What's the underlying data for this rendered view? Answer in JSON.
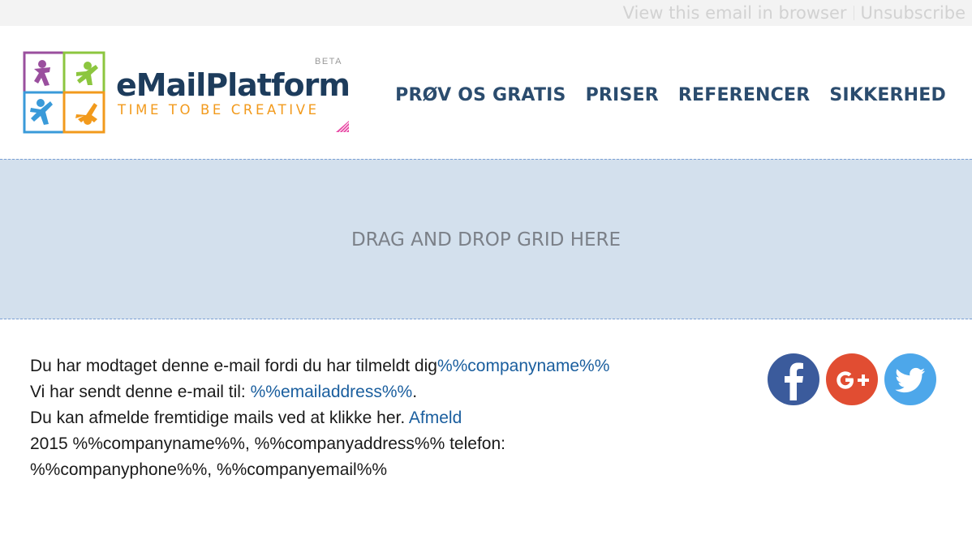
{
  "topbar": {
    "view_in_browser": "View this email in browser",
    "unsubscribe": "Unsubscribe"
  },
  "logo": {
    "name": "eMailPlatform",
    "tagline": "TIME TO BE CREATIVE",
    "badge": "BETA"
  },
  "nav": {
    "items": [
      {
        "label": "PRØV OS GRATIS"
      },
      {
        "label": "PRISER"
      },
      {
        "label": "REFERENCER"
      },
      {
        "label": "SIKKERHED"
      }
    ]
  },
  "dropzone": {
    "label": "DRAG AND DROP GRID HERE"
  },
  "footer": {
    "line1_text": "Du har modtaget denne e-mail fordi du har tilmeldt dig",
    "line1_link": "%%companyname%%",
    "line2_text": "Vi har sendt denne e-mail til: ",
    "line2_link": "%%emailaddress%%",
    "line2_end": ".",
    "line3_text": "Du kan afmelde fremtidige mails ved at klikke her. ",
    "line3_link": "Afmeld",
    "line4_text": "2015 %%companyname%%, %%companyaddress%% telefon: %%companyphone%%, %%companyemail%%"
  },
  "social": {
    "icons": [
      "facebook-icon",
      "google-plus-icon",
      "twitter-icon"
    ],
    "colors": {
      "facebook": "#3b5b9c",
      "google_plus": "#e14d32",
      "twitter": "#4da7ea"
    }
  },
  "colors": {
    "brand_navy": "#1d3c5c",
    "brand_orange": "#f29a1c",
    "nav": "#2b4c6e",
    "link": "#1a5e9e",
    "dropzone_bg": "#d3e0ed",
    "dropzone_border": "#7a9fd4"
  }
}
